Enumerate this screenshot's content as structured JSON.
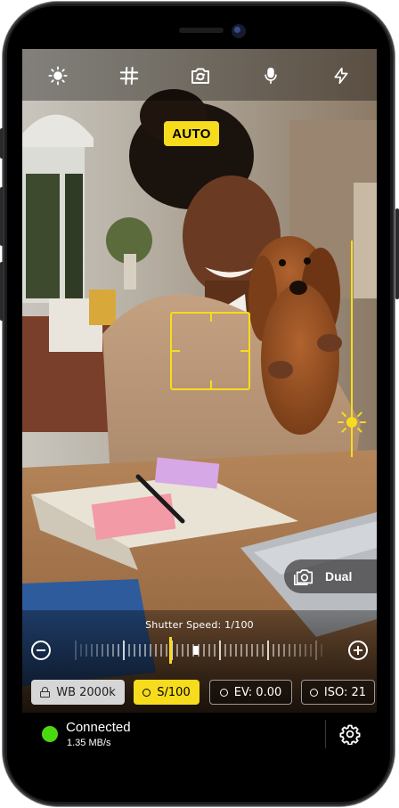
{
  "viewfinder": {
    "mode_badge": "AUTO"
  },
  "toolbar": {
    "icons": [
      "brightness-icon",
      "grid-icon",
      "switch-camera-icon",
      "microphone-icon",
      "flash-icon"
    ]
  },
  "dual_button": {
    "label": "Dual",
    "icon": "camera-icon"
  },
  "shutter": {
    "title": "Shutter Speed: 1/100",
    "decrease_icon": "minus-circle-icon",
    "increase_icon": "plus-circle-icon"
  },
  "chips": {
    "wb": "WB 2000k",
    "shutter": "S/100",
    "ev": "EV: 0.00",
    "iso": "ISO: 21"
  },
  "status": {
    "title": "Connected",
    "speed": "1.35 MB/s",
    "dot_color": "#4cd713",
    "settings_icon": "gear-icon"
  },
  "colors": {
    "accent": "#f7dc1e"
  }
}
